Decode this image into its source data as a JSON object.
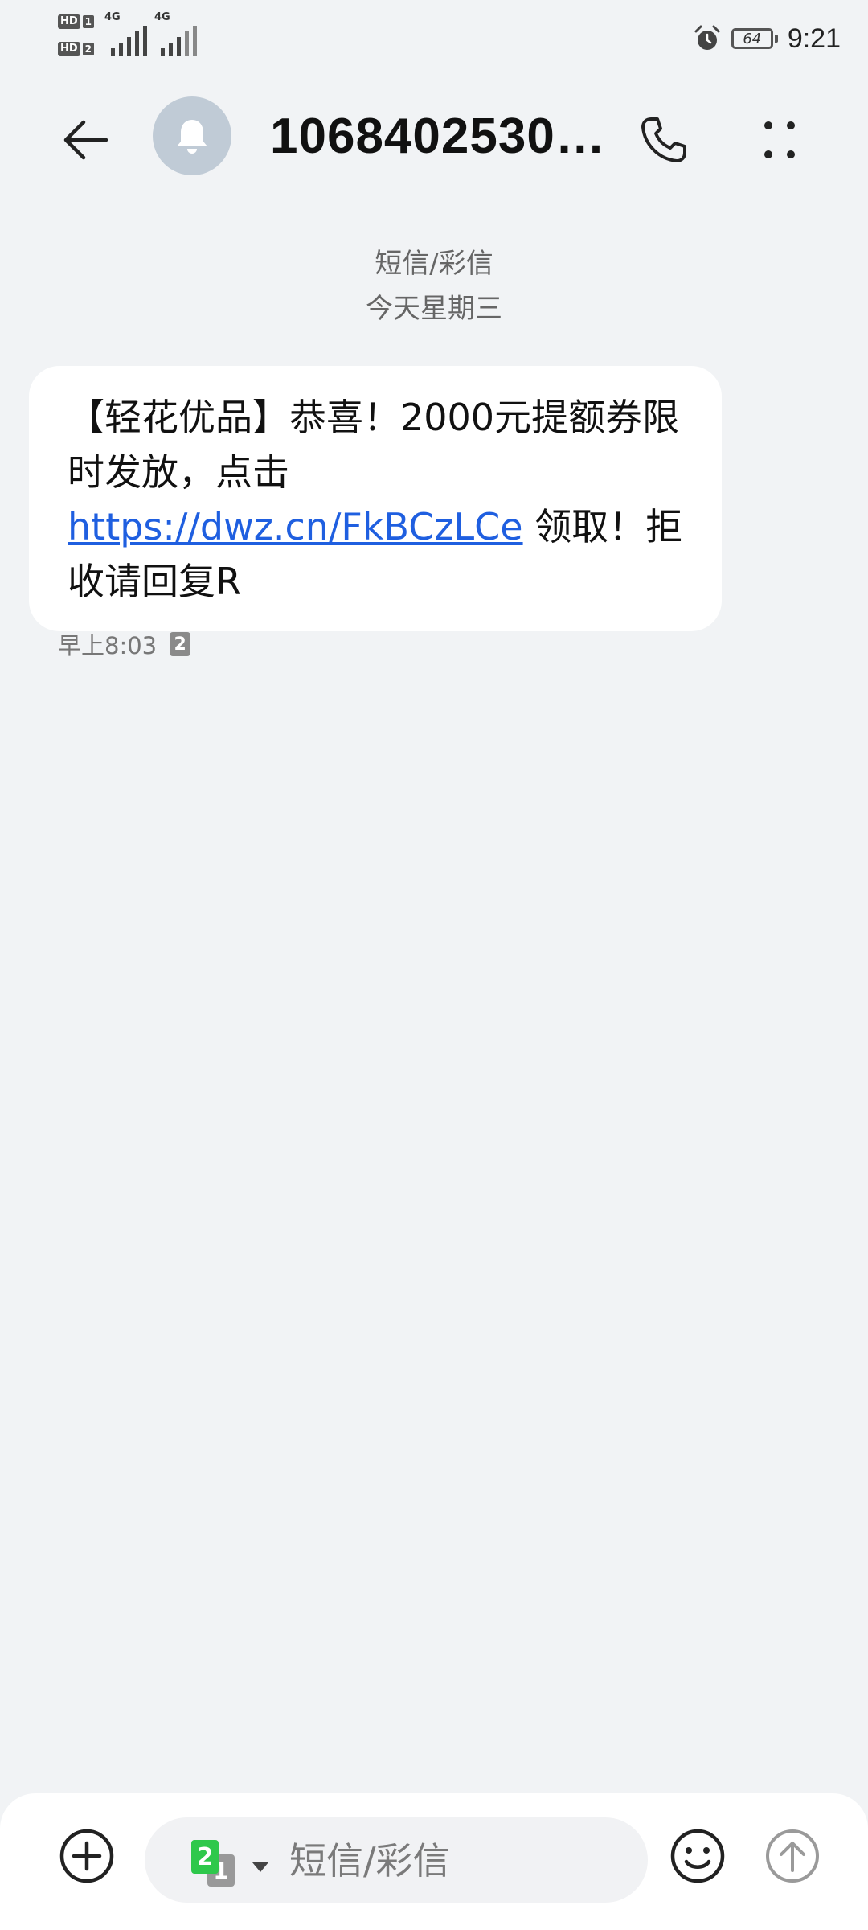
{
  "status_bar": {
    "sim1_label": "HD",
    "sim1_number": "1",
    "sim2_label": "HD",
    "sim2_number": "2",
    "network1": "4G",
    "network2": "4G",
    "battery": "64",
    "time": "9:21"
  },
  "header": {
    "title": "1068402530…"
  },
  "conversation": {
    "type_label": "短信/彩信",
    "date_label": "今天星期三",
    "messages": [
      {
        "text_before": "【轻花优品】恭喜！2000元提额券限时发放，点击 ",
        "link": "https://dwz.cn/FkBCzLCe",
        "text_after": " 领取！拒收请回复R",
        "time": "早上8:03",
        "sim": "2"
      }
    ]
  },
  "composer": {
    "placeholder": "短信/彩信",
    "sim_front": "2",
    "sim_back": "1"
  },
  "colors": {
    "background": "#f1f3f5",
    "bubble": "#ffffff",
    "link": "#1f5fe0",
    "avatar": "#c0cbd6",
    "sim_green": "#2ec84b"
  },
  "icons": {
    "back": "arrow-left-icon",
    "avatar": "bell-icon",
    "call": "phone-icon",
    "more": "vertical-dots-icon",
    "attach": "plus-circle-icon",
    "emoji": "smiley-icon",
    "send": "arrow-up-circle-icon",
    "alarm": "alarm-icon"
  }
}
